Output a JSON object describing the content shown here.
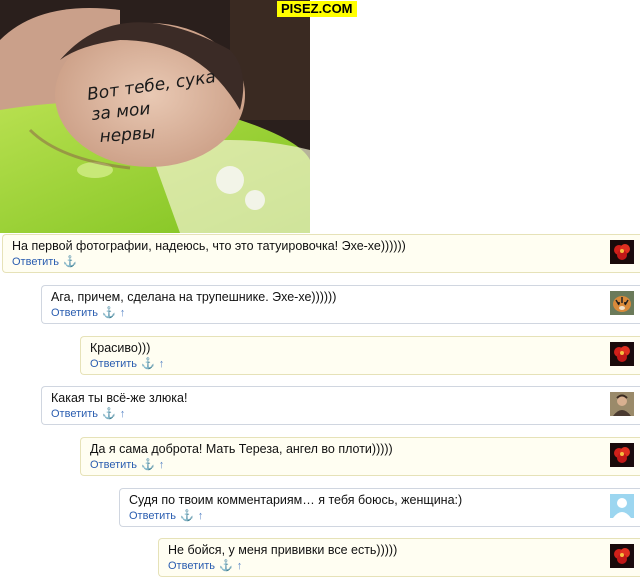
{
  "watermark": "PISEZ.COM",
  "photo": {
    "forehead_text_lines": [
      "Вот тебе, сука",
      "за мои",
      "нервы"
    ]
  },
  "comments": [
    {
      "text": "На первой фотографии, надеюсь, что это татуировочка! Эхе-хе))))))",
      "reply": "Ответить",
      "anchor": "⚓",
      "up": "",
      "avatar": "flower-red-avatar"
    },
    {
      "text": "Ага, причем, сделана на трупешнике. Эхе-хе))))))",
      "reply": "Ответить",
      "anchor": "⚓",
      "up": "↑",
      "avatar": "tiger-avatar"
    },
    {
      "text": "Красиво)))",
      "reply": "Ответить",
      "anchor": "⚓",
      "up": "↑",
      "avatar": "flower-red-avatar"
    },
    {
      "text": "Какая ты всё-же злюка!",
      "reply": "Ответить",
      "anchor": "⚓",
      "up": "↑",
      "avatar": "person-avatar"
    },
    {
      "text": "Да я сама доброта! Мать Тереза, ангел во плоти)))))",
      "reply": "Ответить",
      "anchor": "⚓",
      "up": "↑",
      "avatar": "flower-red-avatar"
    },
    {
      "text": "Судя по твоим комментариям… я тебя боюсь, женщина:)",
      "reply": "Ответить",
      "anchor": "⚓",
      "up": "↑",
      "avatar": "default-user-avatar"
    },
    {
      "text": "Не бойся, у меня прививки все есть)))))",
      "reply": "Ответить",
      "anchor": "⚓",
      "up": "↑",
      "avatar": "flower-red-avatar"
    }
  ],
  "colors": {
    "link": "#2a5db0",
    "watermark_bg": "#ffff00",
    "yellow_box": "#fffef2"
  }
}
